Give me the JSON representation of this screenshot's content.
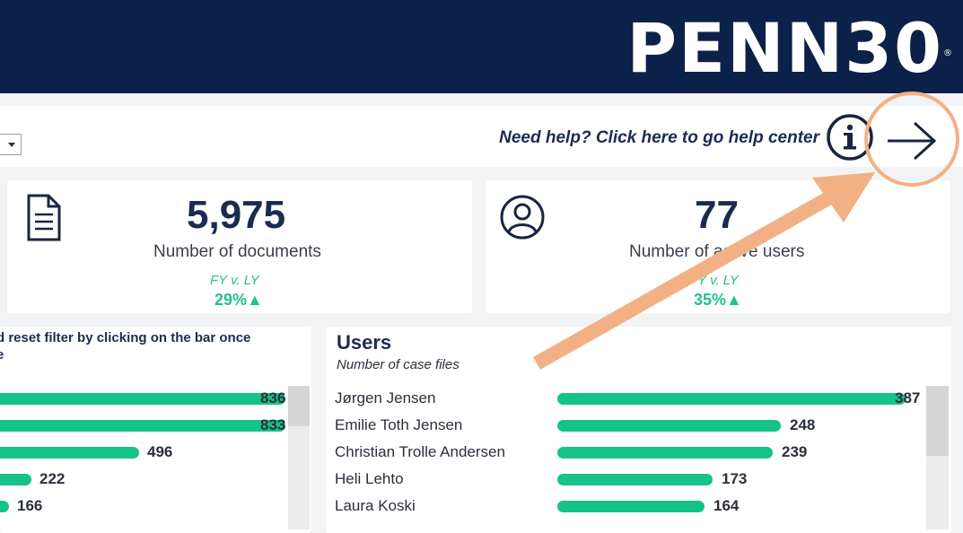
{
  "brand": {
    "logo_text": "PENN30",
    "registered": "®"
  },
  "topbar": {
    "help_text": "Need help? Click here to go help center"
  },
  "kpis": [
    {
      "value": "5,975",
      "label": "Number of documents",
      "period": "FY v. LY",
      "change": "29%▲",
      "icon": "document-icon"
    },
    {
      "value": "77",
      "label": "Number of active users",
      "period": "FY v. LY",
      "change": "35%▲",
      "icon": "user-circle-icon"
    }
  ],
  "left_panel": {
    "note_line1": "d reset filter by clicking on the bar once",
    "note_line2": "e",
    "values": [
      836,
      833,
      496,
      222,
      166
    ]
  },
  "users_panel": {
    "title": "Users",
    "subtitle": "Number of case files",
    "rows": [
      {
        "name": "Jørgen Jensen",
        "value": 387
      },
      {
        "name": "Emilie Toth Jensen",
        "value": 248
      },
      {
        "name": "Christian Trolle Andersen",
        "value": 239
      },
      {
        "name": "Heli Lehto",
        "value": 173
      },
      {
        "name": "Laura Koski",
        "value": 164
      }
    ]
  },
  "colors": {
    "header": "#0c2149",
    "accent": "#16c387",
    "annotation": "#f2b184"
  }
}
